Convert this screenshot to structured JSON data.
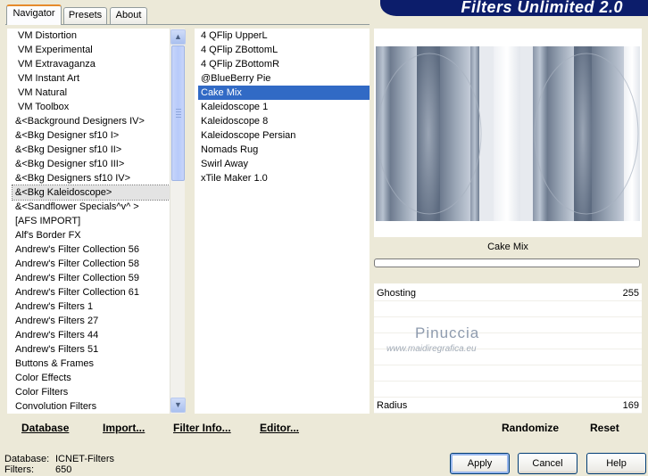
{
  "app": {
    "title": "Filters Unlimited 2.0"
  },
  "tabs": [
    {
      "label": "Navigator",
      "active": true
    },
    {
      "label": "Presets",
      "active": false
    },
    {
      "label": "About",
      "active": false
    }
  ],
  "categories": [
    "VM Distortion",
    "VM Experimental",
    "VM Extravaganza",
    "VM Instant Art",
    "VM Natural",
    "VM Toolbox",
    "&<Background Designers IV>",
    "&<Bkg Designer sf10 I>",
    "&<Bkg Designer sf10 II>",
    "&<Bkg Designer sf10 III>",
    "&<Bkg Designers sf10 IV>",
    "&<Bkg Kaleidoscope>",
    "&<Sandflower Specials^v^ >",
    "[AFS IMPORT]",
    "Alf's Border FX",
    "Andrew's Filter Collection 56",
    "Andrew's Filter Collection 58",
    "Andrew's Filter Collection 59",
    "Andrew's Filter Collection 61",
    "Andrew's Filters 1",
    "Andrew's Filters 27",
    "Andrew's Filters 44",
    "Andrew's Filters 51",
    "Buttons & Frames",
    "Color Effects",
    "Color Filters",
    "Convolution Filters"
  ],
  "selected_category": "&<Bkg Kaleidoscope>",
  "filters": [
    "4 QFlip UpperL",
    "4 QFlip ZBottomL",
    "4 QFlip ZBottomR",
    "@BlueBerry Pie",
    "Cake Mix",
    "Kaleidoscope 1",
    "Kaleidoscope 8",
    "Kaleidoscope Persian",
    "Nomads Rug",
    "Swirl Away",
    "xTile Maker 1.0"
  ],
  "selected_filter": "Cake Mix",
  "left_buttons": {
    "database": "Database",
    "import": "Import...",
    "filter_info": "Filter Info...",
    "editor": "Editor..."
  },
  "preview": {
    "filter_name": "Cake Mix"
  },
  "params": [
    {
      "label": "Ghosting",
      "value": "255"
    },
    {
      "label": "Radius",
      "value": "169"
    }
  ],
  "watermark": {
    "name": "Pinuccia",
    "site": "www.maidiregrafica.eu"
  },
  "right_buttons": {
    "randomize": "Randomize",
    "reset": "Reset"
  },
  "status": {
    "database_label": "Database:",
    "database_value": "ICNET-Filters",
    "filters_label": "Filters:",
    "filters_value": "650"
  },
  "dialog_buttons": {
    "apply": "Apply",
    "cancel": "Cancel",
    "help": "Help"
  },
  "colors": {
    "banner": "#0c1d6b",
    "selection": "#316ac5",
    "tab_accent": "#e68b2c"
  }
}
